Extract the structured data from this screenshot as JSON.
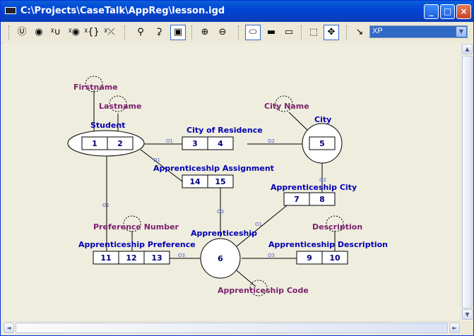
{
  "window": {
    "title": "C:\\Projects\\CaseTalk\\AppReg\\lesson.igd",
    "buttons": [
      "_",
      "□",
      "×"
    ]
  },
  "toolbar": {
    "tools": [
      {
        "name": "unique-constraint-tool",
        "glyph": "Ⓤ"
      },
      {
        "name": "total-role-tool",
        "glyph": "◉"
      },
      {
        "name": "subset-tool",
        "glyph": "ᵡ∪"
      },
      {
        "name": "equality-tool",
        "glyph": "ᵡ◉"
      },
      {
        "name": "exclusion-tool",
        "glyph": "ᵡ{}"
      },
      {
        "name": "delete-constraint-tool",
        "glyph": "ᵡ⤫"
      },
      {
        "name": "link-tool",
        "glyph": "⚲"
      },
      {
        "name": "unlink-tool",
        "glyph": "⚳"
      },
      {
        "name": "select-tool",
        "glyph": "▣"
      },
      {
        "name": "zoom-in-tool",
        "glyph": "⊕"
      },
      {
        "name": "zoom-out-tool",
        "glyph": "⊖"
      },
      {
        "name": "object-view-tool",
        "glyph": "⬭"
      },
      {
        "name": "fact-view-tool",
        "glyph": "▬"
      },
      {
        "name": "role-view-tool",
        "glyph": "▭"
      },
      {
        "name": "marquee-tool",
        "glyph": "⬚"
      },
      {
        "name": "pan-tool",
        "glyph": "✥"
      },
      {
        "name": "arrange-tool",
        "glyph": "↘"
      }
    ],
    "style_combo": "XP",
    "combo_arrow": "▼"
  },
  "diagram": {
    "colors": {
      "fact_label": "#0000b4",
      "role_label": "#0000b4",
      "value_label": "#7a1f6e",
      "constraint": "#4a5fc8",
      "line": "#000000"
    },
    "labels": {
      "firstname": "Firstname",
      "lastname": "Lastname",
      "student": "Student",
      "city_of_residence": "City of Residence",
      "city_name": "City Name",
      "city": "City",
      "apprenticeship_assignment": "Apprenticeship Assignment",
      "apprenticeship_city": "Apprenticeship City",
      "preference_number": "Preference Number",
      "apprenticeship": "Apprenticeship",
      "description": "Description",
      "apprenticeship_preference": "Apprenticeship Preference",
      "apprenticeship_description": "Apprenticeship Description",
      "apprenticeship_code": "Apprenticeship Code"
    },
    "roles": [
      "1",
      "2",
      "3",
      "4",
      "5",
      "14",
      "15",
      "7",
      "8",
      "11",
      "12",
      "13",
      "6",
      "9",
      "10"
    ],
    "constraints": [
      "O1",
      "O2",
      "O1",
      "O2",
      "O3",
      "O1",
      "O1",
      "O3",
      "O3"
    ]
  },
  "scroll": {
    "up": "▲",
    "down": "▼",
    "left": "◄",
    "right": "►"
  }
}
